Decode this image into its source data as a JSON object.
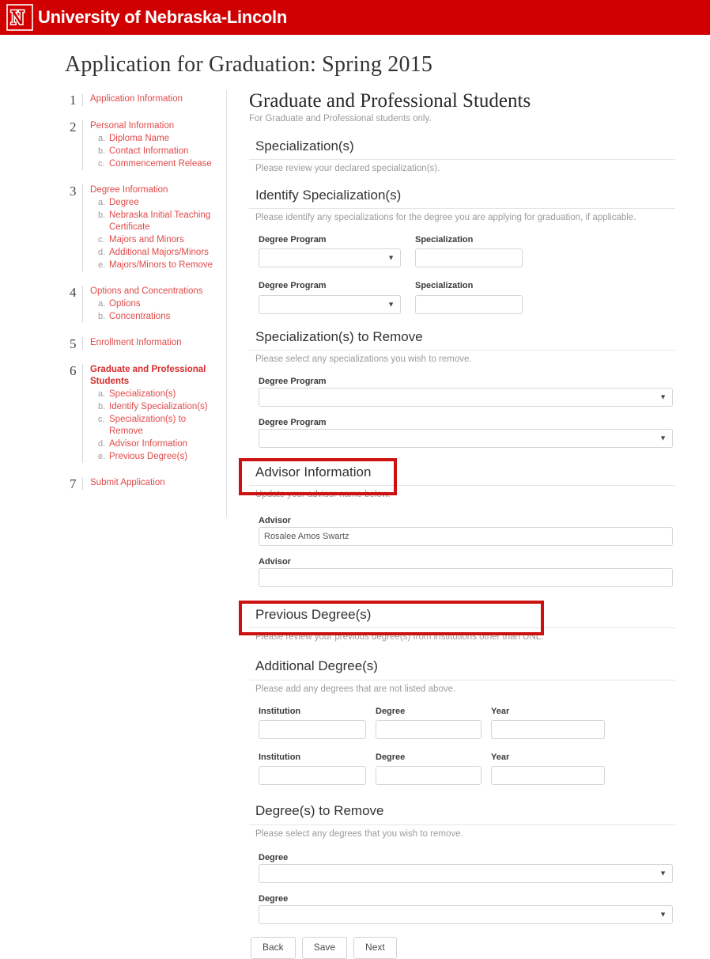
{
  "masthead": {
    "logo_icon": "unl-n-logo-icon",
    "title": "University of Nebraska-Lincoln",
    "brand_color": "#d00000"
  },
  "page_title": "Application for Graduation: Spring 2015",
  "sidebar": {
    "steps": [
      {
        "num": "1",
        "label": "Application Information",
        "current": false,
        "subs": []
      },
      {
        "num": "2",
        "label": "Personal Information",
        "current": false,
        "subs": [
          {
            "letter": "a.",
            "label": "Diploma Name"
          },
          {
            "letter": "b.",
            "label": "Contact Information"
          },
          {
            "letter": "c.",
            "label": "Commencement Release"
          }
        ]
      },
      {
        "num": "3",
        "label": "Degree Information",
        "current": false,
        "subs": [
          {
            "letter": "a.",
            "label": "Degree"
          },
          {
            "letter": "b.",
            "label": "Nebraska Initial Teaching Certificate"
          },
          {
            "letter": "c.",
            "label": "Majors and Minors"
          },
          {
            "letter": "d.",
            "label": "Additional Majors/Minors"
          },
          {
            "letter": "e.",
            "label": "Majors/Minors to Remove"
          }
        ]
      },
      {
        "num": "4",
        "label": "Options and Concentrations",
        "current": false,
        "subs": [
          {
            "letter": "a.",
            "label": "Options"
          },
          {
            "letter": "b.",
            "label": "Concentrations"
          }
        ]
      },
      {
        "num": "5",
        "label": "Enrollment Information",
        "current": false,
        "subs": []
      },
      {
        "num": "6",
        "label": "Graduate and Professional Students",
        "current": true,
        "subs": [
          {
            "letter": "a.",
            "label": "Specialization(s)"
          },
          {
            "letter": "b.",
            "label": "Identify Specialization(s)"
          },
          {
            "letter": "c.",
            "label": "Specialization(s) to Remove"
          },
          {
            "letter": "d.",
            "label": "Advisor Information"
          },
          {
            "letter": "e.",
            "label": "Previous Degree(s)"
          }
        ]
      },
      {
        "num": "7",
        "label": "Submit Application",
        "current": false,
        "subs": []
      }
    ]
  },
  "main": {
    "title": "Graduate and Professional Students",
    "subtitle": "For Graduate and Professional students only.",
    "sections": {
      "specializations": {
        "heading": "Specialization(s)",
        "desc": "Please review your declared specialization(s)."
      },
      "identify_specializations": {
        "heading": "Identify Specialization(s)",
        "desc": "Please identify any specializations for the degree you are applying for graduation, if applicable.",
        "rows": [
          {
            "program_label": "Degree Program",
            "program_value": "",
            "spec_label": "Specialization",
            "spec_value": ""
          },
          {
            "program_label": "Degree Program",
            "program_value": "",
            "spec_label": "Specialization",
            "spec_value": ""
          }
        ]
      },
      "specializations_to_remove": {
        "heading": "Specialization(s) to Remove",
        "desc": "Please select any specializations you wish to remove.",
        "rows": [
          {
            "label": "Degree Program",
            "value": ""
          },
          {
            "label": "Degree Program",
            "value": ""
          }
        ]
      },
      "advisor_information": {
        "heading": "Advisor Information",
        "desc": "Update your advisor name below.",
        "highlighted": true,
        "rows": [
          {
            "label": "Advisor",
            "value": "Rosalee Amos Swartz"
          },
          {
            "label": "Advisor",
            "value": ""
          }
        ]
      },
      "previous_degrees": {
        "heading": "Previous Degree(s)",
        "desc": "Please review your previous degree(s) from institutions other than UNL.",
        "highlighted": true
      },
      "additional_degrees": {
        "heading": "Additional Degree(s)",
        "desc": "Please add any degrees that are not listed above.",
        "rows": [
          {
            "institution_label": "Institution",
            "institution_value": "",
            "degree_label": "Degree",
            "degree_value": "",
            "year_label": "Year",
            "year_value": ""
          },
          {
            "institution_label": "Institution",
            "institution_value": "",
            "degree_label": "Degree",
            "degree_value": "",
            "year_label": "Year",
            "year_value": ""
          }
        ]
      },
      "degrees_to_remove": {
        "heading": "Degree(s) to Remove",
        "desc": "Please select any degrees that you wish to remove.",
        "rows": [
          {
            "label": "Degree",
            "value": ""
          },
          {
            "label": "Degree",
            "value": ""
          }
        ]
      }
    },
    "buttons": {
      "back": "Back",
      "save": "Save",
      "next": "Next"
    }
  },
  "colors": {
    "brand_red": "#d00000",
    "link_red": "#e04a4a",
    "annotation_red": "#cc1111"
  }
}
